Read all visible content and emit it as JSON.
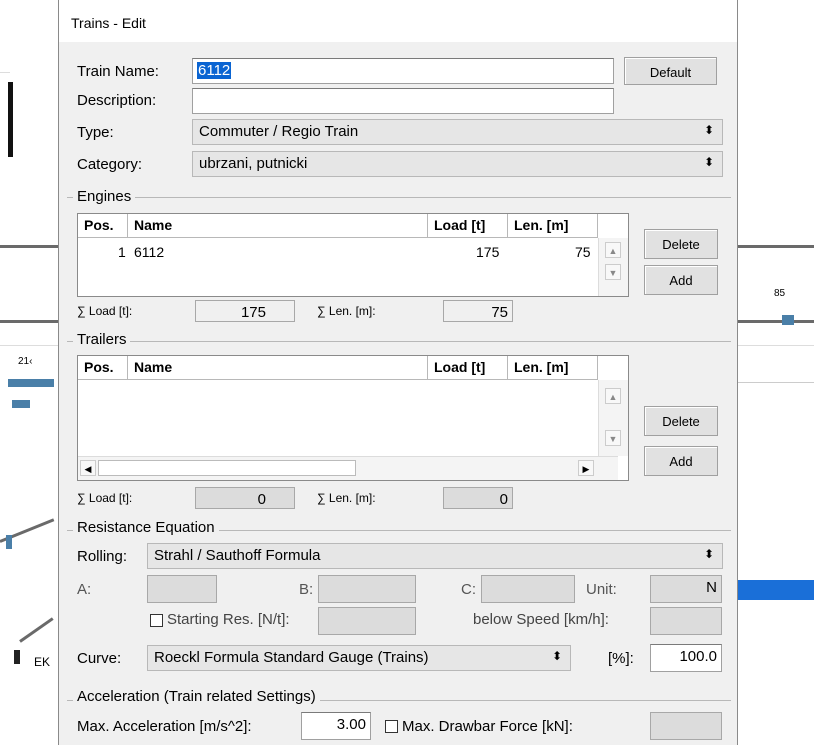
{
  "window": {
    "title": "Trains - Edit"
  },
  "background": {
    "label_85": "85",
    "label_21": "21‹",
    "label_ek": "EK"
  },
  "train_name": {
    "label": "Train Name:",
    "value": "6112",
    "default_btn": "Default"
  },
  "description": {
    "label": "Description:",
    "value": ""
  },
  "type": {
    "label": "Type:",
    "value": "Commuter / Regio Train"
  },
  "category": {
    "label": "Category:",
    "value": "ubrzani, putnicki"
  },
  "engines": {
    "title": "Engines",
    "columns": [
      "Pos.",
      "Name",
      "Load [t]",
      "Len. [m]"
    ],
    "rows": [
      {
        "pos": "1",
        "name": "6112",
        "load": "175",
        "len": "75"
      }
    ],
    "delete_btn": "Delete",
    "add_btn": "Add",
    "sum_load_label": "∑ Load [t]:",
    "sum_load": "175",
    "sum_len_label": "∑ Len. [m]:",
    "sum_len": "75"
  },
  "trailers": {
    "title": "Trailers",
    "columns": [
      "Pos.",
      "Name",
      "Load [t]",
      "Len. [m]"
    ],
    "rows": [],
    "delete_btn": "Delete",
    "add_btn": "Add",
    "sum_load_label": "∑ Load [t]:",
    "sum_load": "0",
    "sum_len_label": "∑ Len. [m]:",
    "sum_len": "0"
  },
  "resistance": {
    "title": "Resistance Equation",
    "rolling_label": "Rolling:",
    "rolling_value": "Strahl / Sauthoff Formula",
    "a_label": "A:",
    "b_label": "B:",
    "c_label": "C:",
    "unit_label": "Unit:",
    "unit_value": "N",
    "starting_res_label": "Starting Res. [N/t]:",
    "below_speed_label": "below Speed [km/h]:",
    "curve_label": "Curve:",
    "curve_value": "Roeckl Formula Standard Gauge (Trains)",
    "percent_label": "[%]:",
    "percent_value": "100.0"
  },
  "acceleration": {
    "title": "Acceleration (Train related Settings)",
    "max_accel_label": "Max. Acceleration [m/s^2]:",
    "max_accel_value": "3.00",
    "max_drawbar_label": "Max. Drawbar Force [kN]:"
  }
}
